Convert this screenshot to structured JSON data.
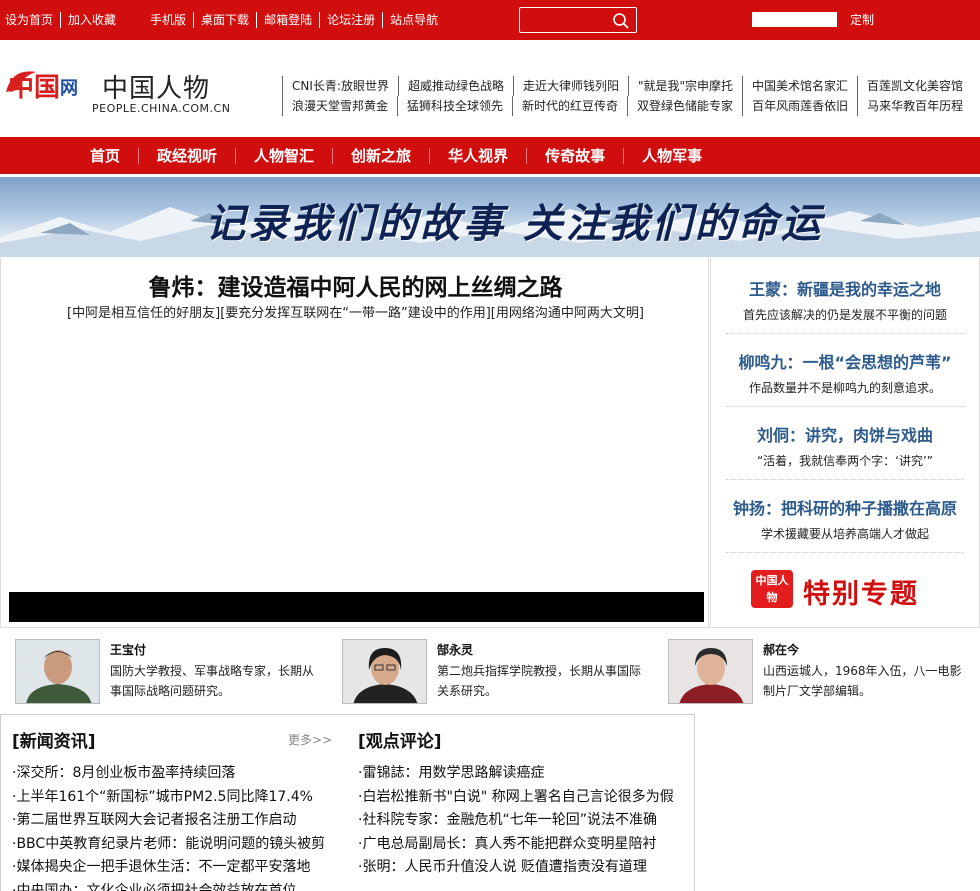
{
  "topbar": {
    "links": [
      "设为首页",
      "加入收藏",
      "手机版",
      "桌面下载",
      "邮箱登陆",
      "论坛注册",
      "站点导航"
    ],
    "search_placeholder": "",
    "custom_label": "定制",
    "color": "#d10e0e"
  },
  "logo": {
    "mark_text": "中国网",
    "title": "中国人物",
    "domain": "PEOPLE.CHINA.COM.CN"
  },
  "headlinks": {
    "row1": [
      "CNI长青:放眼世界",
      "超威推动绿色战略",
      "走近大律师钱列阳",
      "\"就是我\"宗申摩托",
      "中国美术馆名家汇",
      "百莲凯文化美容馆"
    ],
    "row2": [
      "浪漫天堂雪邦黄金",
      "猛狮科技全球领先",
      "新时代的红豆传奇",
      "双登绿色储能专家",
      "百年风雨莲香依旧",
      "马来华教百年历程"
    ]
  },
  "nav": {
    "items": [
      "首页",
      "政经视听",
      "人物智汇",
      "创新之旅",
      "华人视界",
      "传奇故事",
      "人物军事"
    ]
  },
  "banner": {
    "slogan": "记录我们的故事  关注我们的命运"
  },
  "main": {
    "headline": "鲁炜：建设造福中阿人民的网上丝绸之路",
    "sublinks": "[中阿是相互信任的好朋友][要充分发挥互联网在“一带一路”建设中的作用][用网络沟通中阿两大文明]"
  },
  "sidebar": {
    "items": [
      {
        "title": "王蒙：新疆是我的幸运之地",
        "desc": "首先应该解决的仍是发展不平衡的问题"
      },
      {
        "title": "柳鸣九：一根“会思想的芦苇”",
        "desc": "作品数量并不是柳鸣九的刻意追求。"
      },
      {
        "title": "刘侗：讲究，肉饼与戏曲",
        "desc": "“活着，我就信奉两个字：‘讲究’”"
      },
      {
        "title": "钟扬：把科研的种子播撒在高原",
        "desc": "学术援藏要从培养高端人才做起"
      }
    ],
    "special_badge": "中国人物",
    "special_label": "特别专题"
  },
  "people": [
    {
      "name": "王宝付",
      "desc": "国防大学教授、军事战略专家，长期从事国际战略问题研究。"
    },
    {
      "name": "郜永灵",
      "desc": "第二炮兵指挥学院教授，长期从事国际关系研究。"
    },
    {
      "name": "郝在今",
      "desc": "山西运城人，1968年入伍，八一电影制片厂文学部编辑。"
    }
  ],
  "news": {
    "title": "[新闻资讯]",
    "more": "更多>>",
    "items": [
      "·深交所：8月创业板市盈率持续回落",
      "·上半年161个“新国标”城市PM2.5同比降17.4%",
      "·第二届世界互联网大会记者报名注册工作启动",
      "·BBC中英教育纪录片老师：能说明问题的镜头被剪",
      "·媒体揭央企一把手退休生活：不一定都平安落地",
      "·中央国办：文化企业必须把社会效益放在首位"
    ]
  },
  "opinion": {
    "title": "[观点评论]",
    "items": [
      "·雷锦誌：用数学思路解读癌症",
      "·白岩松推新书\"白说\" 称网上署名自己言论很多为假",
      "·社科院专家：金融危机“七年一轮回”说法不准确",
      "·广电总局副局长：真人秀不能把群众变明星陪衬",
      "·张明：人民币升值没人说 贬值遭指责没有道理"
    ]
  }
}
